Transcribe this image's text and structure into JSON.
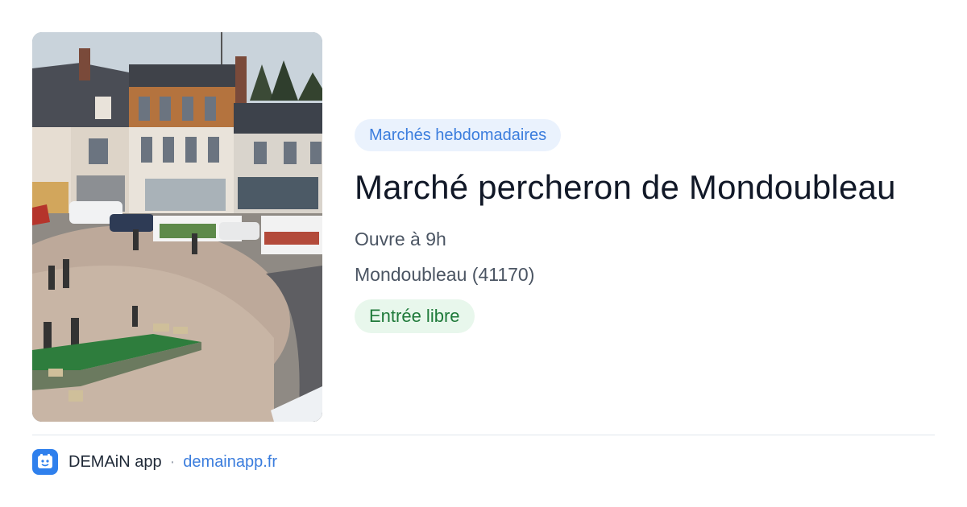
{
  "image": {
    "alt": "Place du marché de Mondoubleau"
  },
  "event": {
    "category": "Marchés hebdomadaires",
    "title": "Marché percheron de Mondoubleau",
    "hours": "Ouvre à 9h",
    "location": "Mondoubleau (41170)",
    "entry": "Entrée libre"
  },
  "footer": {
    "brand": "DEMAiN app",
    "separator": "·",
    "site": "demainapp.fr",
    "icon": "app-logo-icon"
  },
  "colors": {
    "accent": "#3b7ddd",
    "category_bg": "#eaf2fd",
    "entry_text": "#1f7a3a",
    "entry_bg": "#e8f7ec",
    "title": "#111827"
  }
}
